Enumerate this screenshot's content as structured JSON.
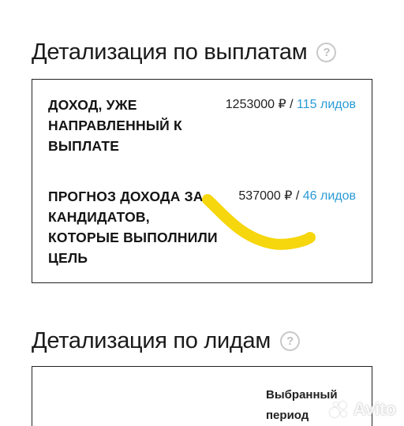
{
  "payouts_section": {
    "title": "Детализация по выплатам",
    "help_icon": "?",
    "rows": [
      {
        "label": "ДОХОД, УЖЕ НАПРАВЛЕННЫЙ К ВЫПЛАТЕ",
        "amount": "1253000 ₽",
        "separator": " / ",
        "leads": "115 лидов"
      },
      {
        "label": "ПРОГНОЗ ДОХОДА ЗА КАНДИДАТОВ, КОТОРЫЕ ВЫПОЛНИЛИ ЦЕЛЬ",
        "amount": "537000 ₽",
        "separator": " / ",
        "leads": "46 лидов"
      }
    ],
    "highlight_color": "#f5d400"
  },
  "leads_section": {
    "title": "Детализация по лидам",
    "help_icon": "?",
    "column_header": "Выбранный период"
  },
  "watermark": {
    "text": "Avito"
  },
  "colors": {
    "accent_link": "#2a9ad6",
    "border": "#222222",
    "text": "#1a1a1a"
  }
}
